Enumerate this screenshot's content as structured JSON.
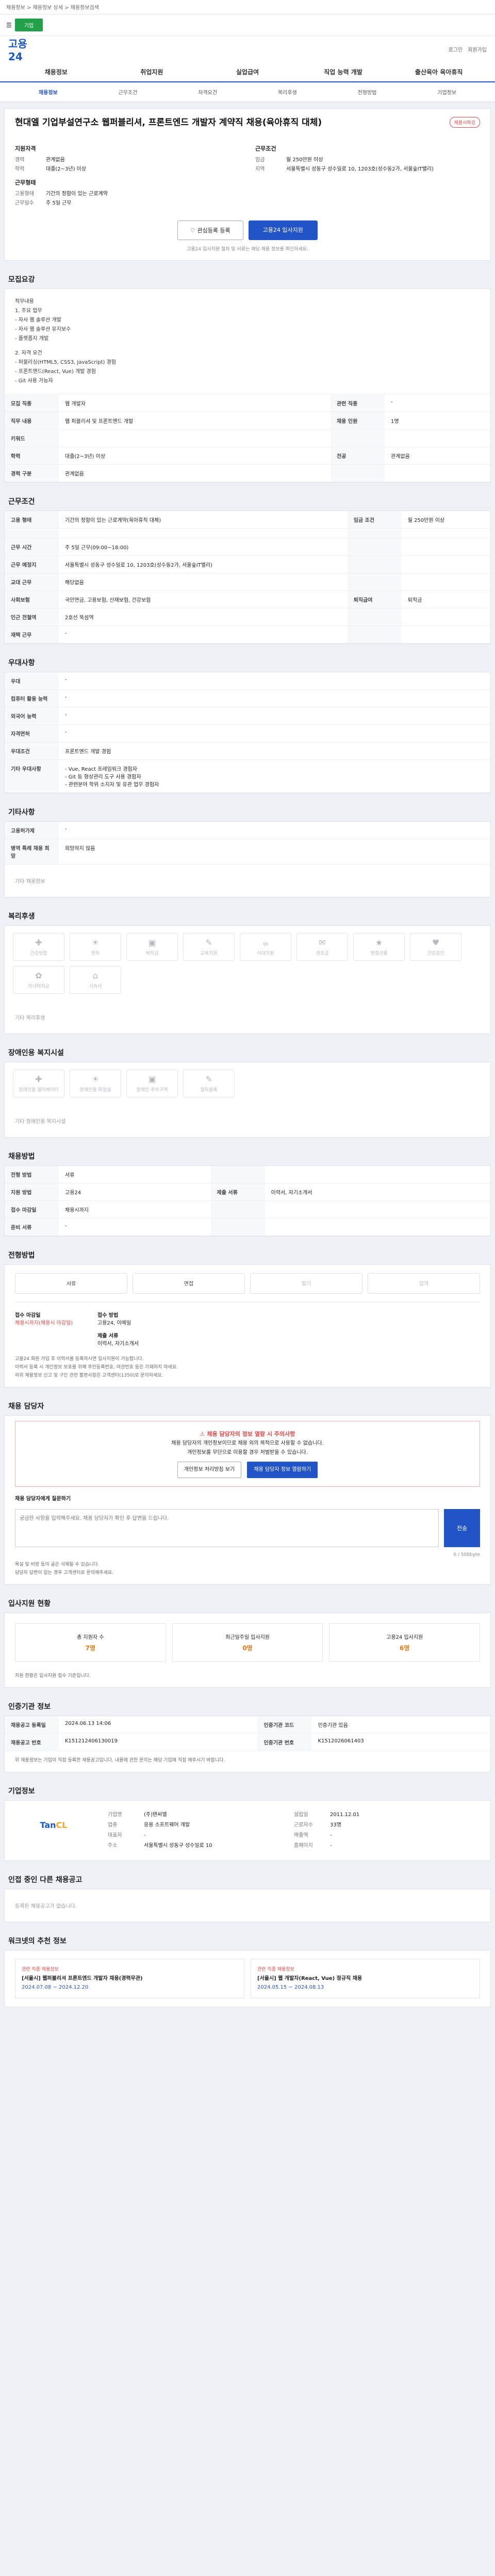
{
  "top_strip": {
    "text": "채용정보 > 채용정보 상세 > 채용정보검색"
  },
  "topbar": {
    "badge": "기업"
  },
  "header": {
    "logo": "고용24",
    "links": [
      "로그인",
      "회원가입"
    ]
  },
  "mainnav": [
    "채용정보",
    "취업지원",
    "실업급여",
    "직업 능력 개발",
    "출산육아 육아휴직"
  ],
  "tabs": [
    "채용정보",
    "근무조건",
    "자격요건",
    "복리후생",
    "전형방법",
    "기업정보"
  ],
  "job": {
    "title": "현대엘 기업부설연구소 웹퍼블리셔, 프론트엔드 개발자 계약직 채용(육아휴직 대체)",
    "status_tag": "채용시마감",
    "left_h": "지원자격",
    "left_rows": [
      [
        "경력",
        "관계없음"
      ],
      [
        "학력",
        "대졸(2~3년) 이상"
      ],
      [
        "",
        ""
      ]
    ],
    "left_h2": "근무형태",
    "left_rows2": [
      [
        "고용형태",
        "기간의 정함이 있는 근로계약"
      ],
      [
        "근무일수",
        "주 5일 근무"
      ]
    ],
    "right_h": "근무조건",
    "right_rows": [
      [
        "임금",
        "월 250만원 이상"
      ],
      [
        "지역",
        "서울특별시 성동구 성수일로 10, 1203호(성수동2가, 서울숲IT밸리)"
      ],
      [
        "",
        ""
      ],
      [
        "",
        ""
      ]
    ],
    "btn_interest": "관심등록 등록",
    "btn_apply": "고용24 입사지원",
    "hint": "고용24 입사지원 절차 및 서류는 해당 채용 정보를 확인하세요."
  },
  "sections": {
    "recruit": "모집요강",
    "work": "근무조건",
    "qual": "우대사항",
    "other": "기타사항",
    "welfare": "복리후생",
    "disabled": "장애인용 복지시설",
    "apply": "채용방법",
    "process": "전형방법",
    "manager": "채용 담당자",
    "reviews": "입사지원 현황",
    "related": "인증기관 정보",
    "company": "기업정보",
    "similar": "인접 중인 다른 채용공고",
    "recommend": "워크넷의 추천 정보"
  },
  "recruit_desc": [
    "직무내용",
    "1. 주요 업무",
    "- 자사 웹 솔루션 개발",
    "- 자사 웹 솔루션 유지보수",
    "- 플랫폼지 개발",
    "",
    "2. 자격 요건",
    "- 퍼블리싱(HTML5, CSS3, JavaScript) 경험",
    "- 프론트엔드(React, Vue) 개발 경험",
    "- Git 사용 가능자"
  ],
  "recruit_table": [
    [
      "모집 직종",
      "웹 개발자",
      "관련 직종",
      "-"
    ],
    [
      "직무 내용",
      "웹 퍼블리셔 및 프론트엔드 개발",
      "채용 인원",
      "1명"
    ],
    [
      "키워드",
      "",
      "",
      ""
    ],
    [
      "학력",
      "대졸(2~3년) 이상",
      "전공",
      "관계없음"
    ],
    [
      "경력 구분",
      "관계없음",
      "",
      ""
    ]
  ],
  "work_table": [
    [
      "고용 형태",
      "기간의 정함이 있는 근로계약(육아휴직 대체)",
      "임금 조건",
      "월 250만원 이상"
    ],
    [
      "",
      "",
      "",
      ""
    ],
    [
      "근무 시간",
      "주 5일 근무(09:00~18:00)",
      "",
      ""
    ],
    [
      "근무 예정지",
      "서울특별시 성동구 성수일로 10, 1203호(성수동2가, 서울숲IT밸리)",
      "",
      ""
    ],
    [
      "교대 근무",
      "해당없음",
      "",
      ""
    ],
    [
      "사회보험",
      "국민연금, 고용보험, 산재보험, 건강보험",
      "퇴직급여",
      "퇴직금"
    ],
    [
      "인근 전철역",
      "2호선 뚝섬역",
      "",
      ""
    ],
    [
      "재택 근무",
      "-",
      "",
      ""
    ]
  ],
  "qual_table": [
    [
      "우대",
      "-"
    ],
    [
      "컴퓨터 활용 능력",
      "-"
    ],
    [
      "외국어 능력",
      "-"
    ],
    [
      "자격면허",
      "-"
    ],
    [
      "우대조건",
      "프론트엔드 개발 경험"
    ],
    [
      "기타 우대사항",
      "- Vue, React 프레임워크 경험자\n- Git 등 형상관리 도구 사용 경험자\n- 관련분야 학위 소지자 및 유관 업무 경험자"
    ]
  ],
  "other_table": [
    [
      "고용허가제",
      "-"
    ],
    [
      "병역 특례 채용 희망",
      "희망하지 않음"
    ]
  ],
  "other_note": "기타 채용정보",
  "welfare_items": [
    "건강보험",
    "연차",
    "퇴직금",
    "교육지원",
    "식대지원",
    "경조금",
    "명절선물",
    "건강검진",
    "자녀학자금",
    "기숙사"
  ],
  "welfare_note": "기타 복리후생",
  "disabled_items": [
    "장애인용 엘리베이터",
    "장애인용 화장실",
    "장애인 주차구역",
    "점자블록"
  ],
  "disabled_note": "기타 장애인용 복지시설",
  "apply_table": [
    [
      "전형 방법",
      "서류",
      "",
      ""
    ],
    [
      "지원 방법",
      "고용24",
      "제출 서류",
      "이력서, 자기소개서"
    ],
    [
      "접수 마감일",
      "채용시까지",
      "",
      ""
    ],
    [
      "준비 서류",
      "-",
      "",
      ""
    ]
  ],
  "process_steps": [
    "서류",
    "면접",
    "필기",
    "합격"
  ],
  "contact": {
    "left_h": "접수 마감일",
    "left_v": "채용시까지(채용시 마감일)",
    "right_h": "접수 방법",
    "right_v": "고용24, 이메일",
    "right_h2": "제출 서류",
    "right_v2": "이력서, 자기소개서"
  },
  "notes": [
    "고용24 회원 가입 후 이력서를 등록하시면 입사지원이 가능합니다.",
    "이력서 등록 시 개인정보 보호를 위해 주민등록번호, 여권번호 등은 기재하지 마세요.",
    "허위 채용정보 신고 및 구인 관련 불편사항은 고객센터(1350)로 문의하세요."
  ],
  "warn": {
    "head": "채용 담당자의 정보 열람 시 주의사항",
    "line1": "채용 담당자의 개인정보이므로 채용 외의 목적으로 사용할 수 없습니다.",
    "line2": "개인정보를 무단으로 이용할 경우 처벌받을 수 있습니다.",
    "btn1": "개인정보 처리방침 보기",
    "btn2": "채용 담당자 정보 열람하기"
  },
  "qa": {
    "label": "채용 담당자에게 질문하기",
    "placeholder": "궁금한 사항을 입력해주세요. 채용 담당자가 확인 후 답변을 드립니다.",
    "btn": "전송",
    "counter": "0 / 500byte",
    "notes": [
      "욕설 및 비방 등의 글은 삭제될 수 있습니다.",
      "담당자 답변이 없는 경우 고객센터로 문의해주세요."
    ]
  },
  "stats": [
    {
      "label": "총 지원자 수",
      "n": "7명"
    },
    {
      "label": "최근일주일 입사지원",
      "n": "0명"
    },
    {
      "label": "고용24 입사지원",
      "n": "6명"
    }
  ],
  "stats_note": "지원 현황은 입사지원 접수 기준입니다.",
  "cert_table": [
    [
      "채용공고 등록일",
      "2024.06.13 14:06",
      "인증기관 코드",
      "인증기관 있음"
    ],
    [
      "채용공고 번호",
      "K151212406130019",
      "인증기관 번호",
      "K1512026061403"
    ]
  ],
  "cert_note": "위 채용정보는 기업이 직접 등록한 채용공고입니다. 내용에 관한 문의는 해당 기업에 직접 해주시기 바랍니다.",
  "company": {
    "logo_a": "Tan",
    "logo_b": "CL",
    "rows": [
      [
        "기업명",
        "(주)탠씨엘",
        "설립일",
        "2011.12.01"
      ],
      [
        "업종",
        "응용 소프트웨어 개발",
        "근로자수",
        "33명"
      ],
      [
        "대표자",
        "-",
        "매출액",
        "-"
      ],
      [
        "주소",
        "서울특별시 성동구 성수일로 10",
        "홈페이지",
        "-"
      ]
    ]
  },
  "similar_note": "등록된 채용공고가 없습니다.",
  "rec_cards": [
    {
      "lb": "관련 직종 채용정보",
      "tt": "[서울시] 웹퍼블리셔 프론트엔드 개발자 채용(경력무관)",
      "dt": "2024.07.08 ~ 2024.12.20"
    },
    {
      "lb": "관련 직종 채용정보",
      "tt": "[서울시] 웹 개발자(React, Vue) 정규직 채용",
      "dt": "2024.05.15 ~ 2024.08.13"
    }
  ]
}
